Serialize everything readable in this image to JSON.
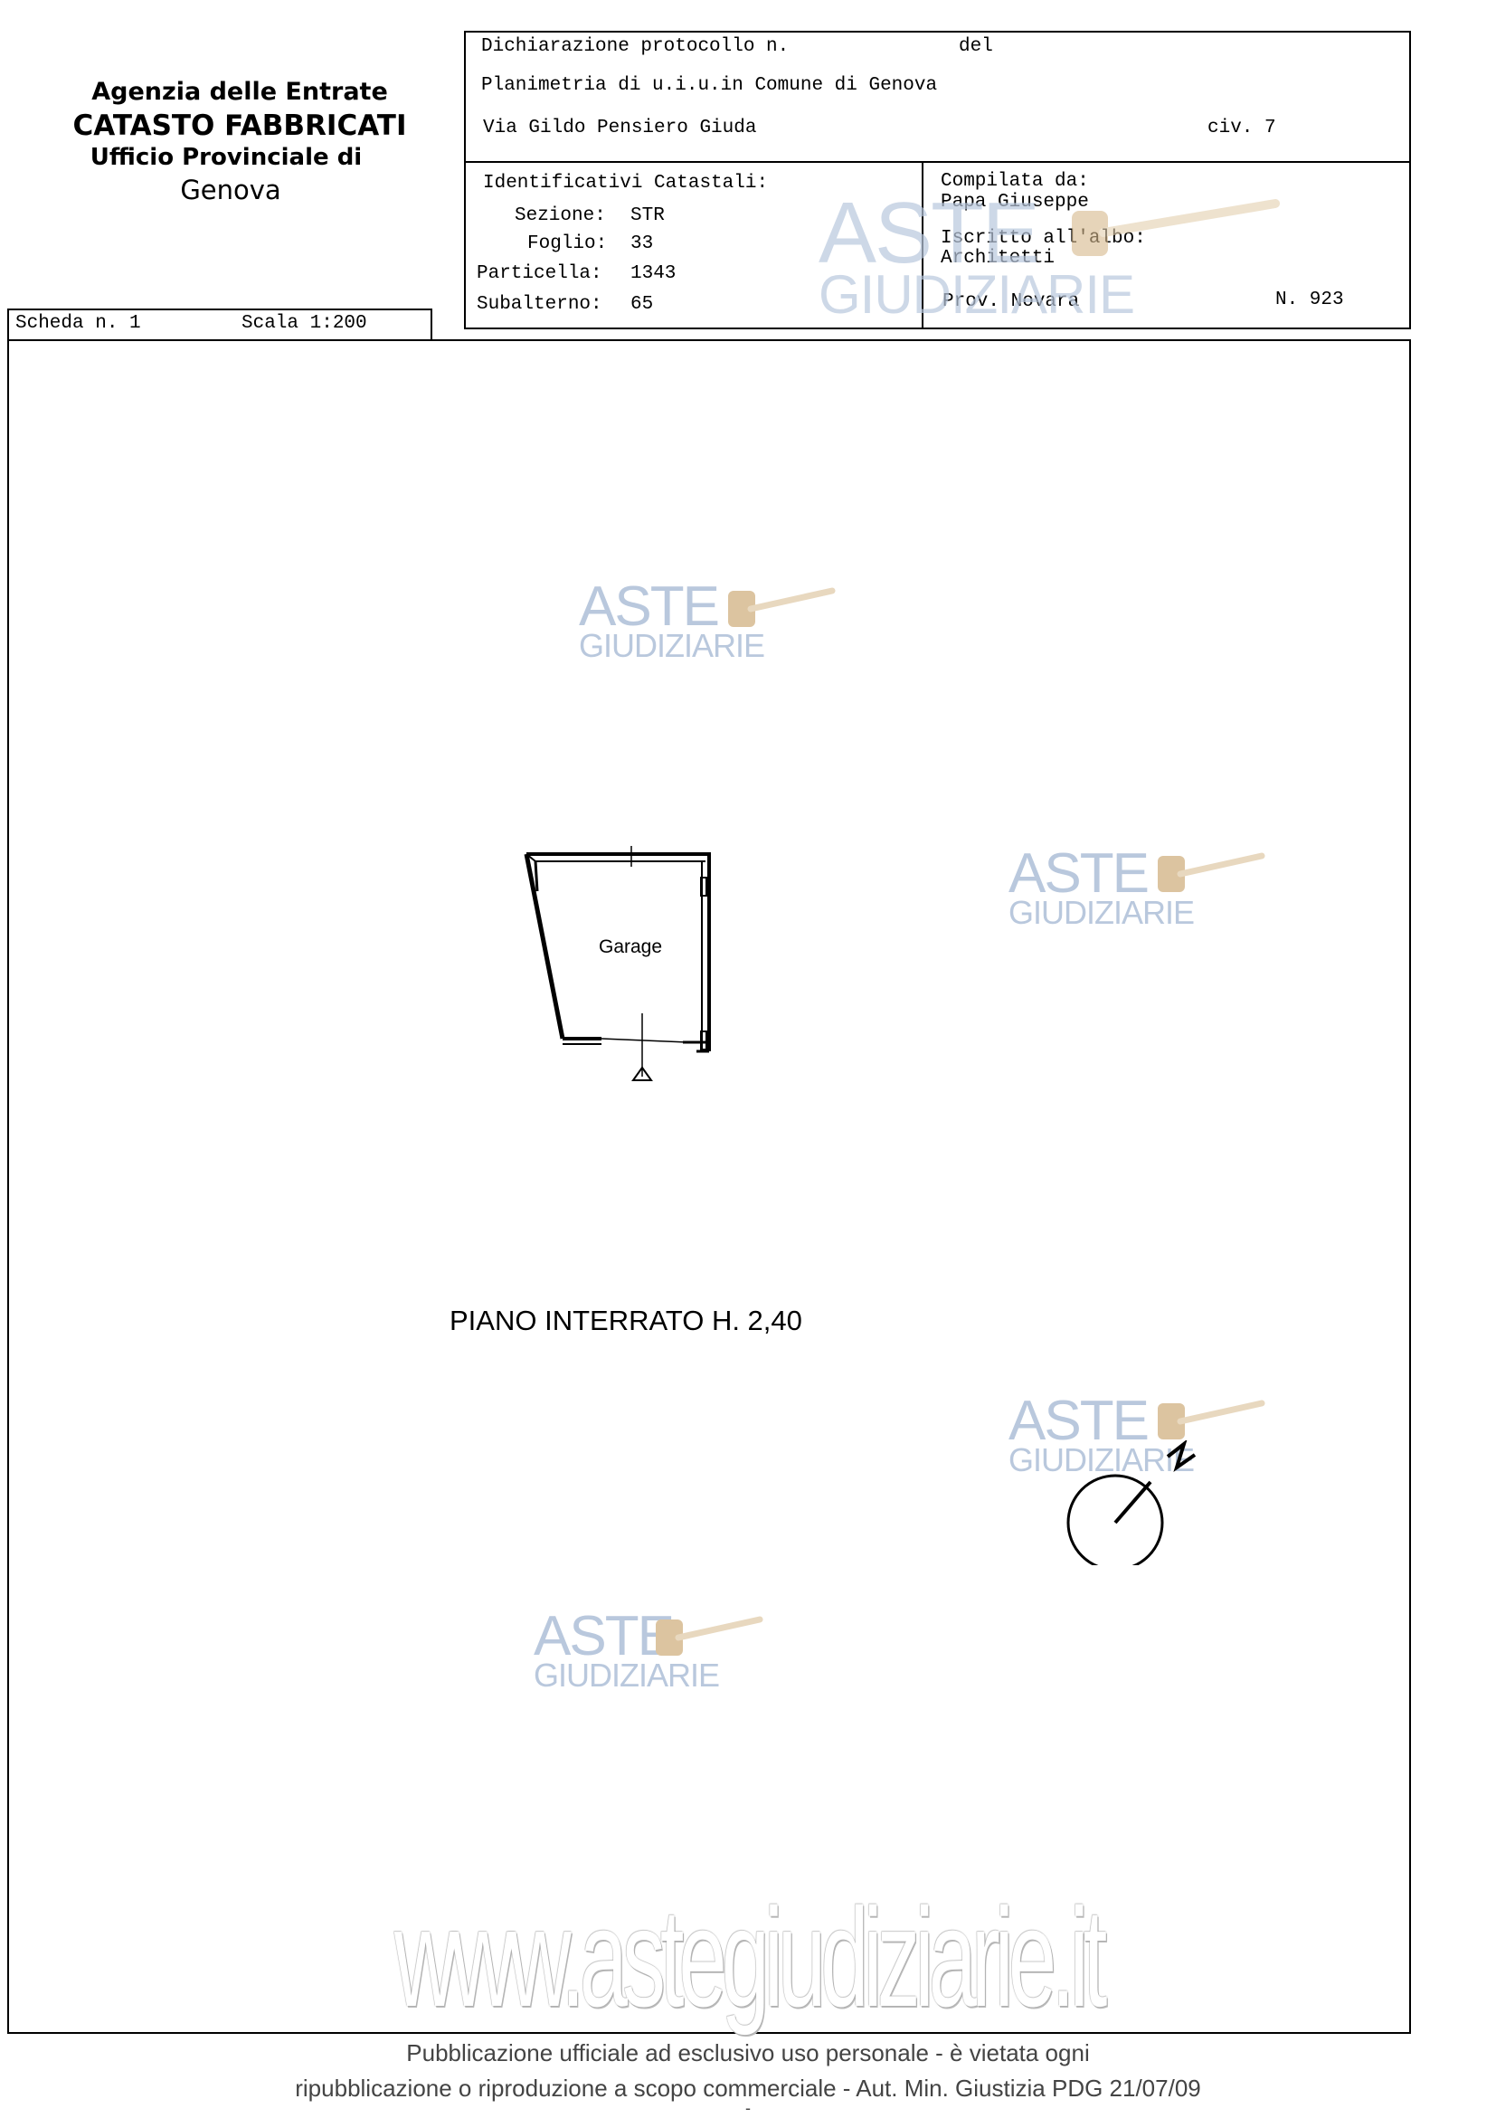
{
  "agency": {
    "line1": "Agenzia delle Entrate",
    "line2": "CATASTO FABBRICATI",
    "line3": "Ufficio Provinciale di",
    "line4": "Genova"
  },
  "header": {
    "protocol_label": "Dichiarazione protocollo n.",
    "protocol_del": "del",
    "planimetria": "Planimetria di u.i.u.in Comune di Genova",
    "address": "Via Gildo Pensiero Giuda",
    "civ": "civ. 7"
  },
  "identificativi": {
    "title": "Identificativi Catastali:",
    "sezione_label": "Sezione:",
    "sezione_value": "STR",
    "foglio_label": "Foglio:",
    "foglio_value": "33",
    "particella_label": "Particella:",
    "particella_value": "1343",
    "subalterno_label": "Subalterno:",
    "subalterno_value": "65"
  },
  "compilata": {
    "label": "Compilata da:",
    "name": "Papa Giuseppe",
    "albo_label": "Iscritto all'albo:",
    "albo_value": "Architetti",
    "prov": "Prov. Novara",
    "numero": "N. 923"
  },
  "scheda": {
    "label": "Scheda n. 1",
    "scala": "Scala 1:200"
  },
  "plan": {
    "room_label": "Garage",
    "floor_caption": "PIANO INTERRATO H. 2,40",
    "north_letter": "N"
  },
  "watermark": {
    "brand_top": "ASTE",
    "brand_bottom": "GIUDIZIARIE",
    "url": "www.astegiudiziarie.it"
  },
  "footer": {
    "line1": "Pubblicazione ufficiale ad esclusivo uso personale - è vietata ogni",
    "line2": "ripubblicazione o riproduzione a scopo commerciale - Aut. Min. Giustizia PDG 21/07/09",
    "dash": "-"
  }
}
